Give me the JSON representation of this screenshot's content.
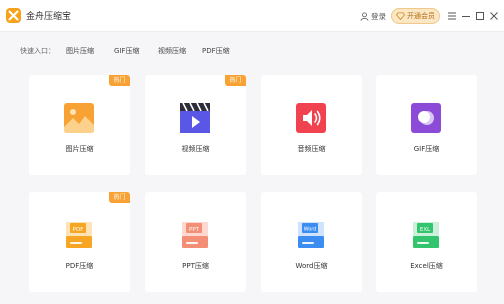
{
  "app": {
    "title": "金舟压缩宝"
  },
  "header": {
    "login_label": "登录",
    "vip_label": "开通会员"
  },
  "quick_access": {
    "label": "快速入口：",
    "links": [
      "图片压缩",
      "GIF压缩",
      "视频压缩",
      "PDF压缩"
    ]
  },
  "badge_label": "热门",
  "tools": [
    {
      "label": "图片压缩",
      "hot": true,
      "icon": "image-icon",
      "color": "#f7a233"
    },
    {
      "label": "视频压缩",
      "hot": true,
      "icon": "video-icon",
      "color": "#5b57e6"
    },
    {
      "label": "音频压缩",
      "hot": false,
      "icon": "audio-icon",
      "color": "#f0434f"
    },
    {
      "label": "GIF压缩",
      "hot": false,
      "icon": "gif-icon",
      "color": "#8c4bd6"
    },
    {
      "label": "PDF压缩",
      "hot": true,
      "icon": "pdf-file-icon",
      "color": "#f6a622",
      "tag": "PDF"
    },
    {
      "label": "PPT压缩",
      "hot": false,
      "icon": "ppt-file-icon",
      "color": "#f48f77",
      "tag": "PPT"
    },
    {
      "label": "Word压缩",
      "hot": false,
      "icon": "word-file-icon",
      "color": "#3b8df2",
      "tag": "Word"
    },
    {
      "label": "Excel压缩",
      "hot": false,
      "icon": "excel-file-icon",
      "color": "#33c46e",
      "tag": "EXL"
    }
  ]
}
